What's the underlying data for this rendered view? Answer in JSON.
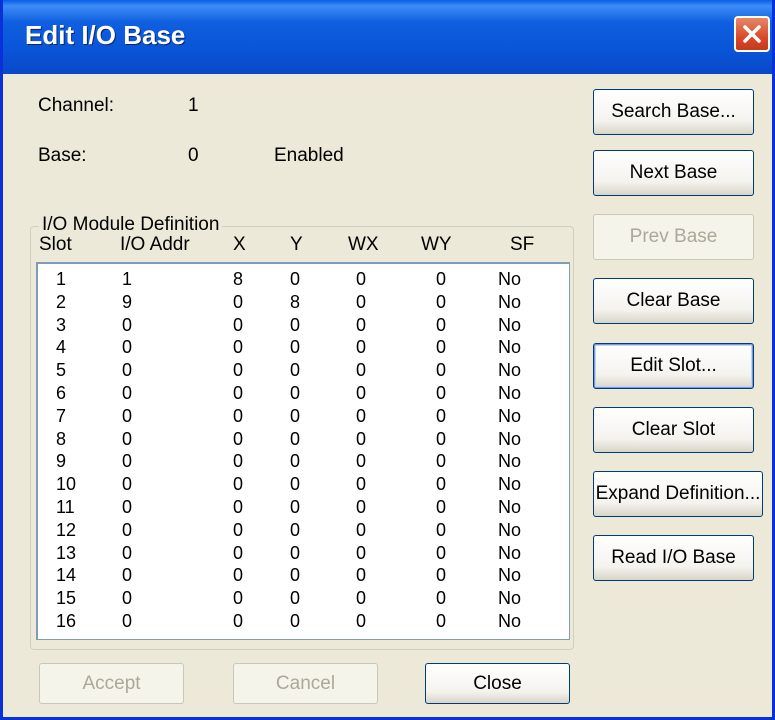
{
  "window": {
    "title": "Edit I/O Base"
  },
  "info": {
    "channel_label": "Channel:",
    "channel_value": "1",
    "base_label": "Base:",
    "base_value": "0",
    "base_status": "Enabled"
  },
  "module_definition": {
    "title": "I/O Module Definition",
    "columns": [
      "Slot",
      "I/O Addr",
      "X",
      "Y",
      "WX",
      "WY",
      "SF"
    ],
    "rows": [
      [
        "1",
        "1",
        "8",
        "0",
        "0",
        "0",
        "No"
      ],
      [
        "2",
        "9",
        "0",
        "8",
        "0",
        "0",
        "No"
      ],
      [
        "3",
        "0",
        "0",
        "0",
        "0",
        "0",
        "No"
      ],
      [
        "4",
        "0",
        "0",
        "0",
        "0",
        "0",
        "No"
      ],
      [
        "5",
        "0",
        "0",
        "0",
        "0",
        "0",
        "No"
      ],
      [
        "6",
        "0",
        "0",
        "0",
        "0",
        "0",
        "No"
      ],
      [
        "7",
        "0",
        "0",
        "0",
        "0",
        "0",
        "No"
      ],
      [
        "8",
        "0",
        "0",
        "0",
        "0",
        "0",
        "No"
      ],
      [
        "9",
        "0",
        "0",
        "0",
        "0",
        "0",
        "No"
      ],
      [
        "10",
        "0",
        "0",
        "0",
        "0",
        "0",
        "No"
      ],
      [
        "11",
        "0",
        "0",
        "0",
        "0",
        "0",
        "No"
      ],
      [
        "12",
        "0",
        "0",
        "0",
        "0",
        "0",
        "No"
      ],
      [
        "13",
        "0",
        "0",
        "0",
        "0",
        "0",
        "No"
      ],
      [
        "14",
        "0",
        "0",
        "0",
        "0",
        "0",
        "No"
      ],
      [
        "15",
        "0",
        "0",
        "0",
        "0",
        "0",
        "No"
      ],
      [
        "16",
        "0",
        "0",
        "0",
        "0",
        "0",
        "No"
      ]
    ]
  },
  "side_buttons": {
    "search_base": "Search Base...",
    "next_base": "Next Base",
    "prev_base": "Prev Base",
    "clear_base": "Clear Base",
    "edit_slot": "Edit Slot...",
    "clear_slot": "Clear Slot",
    "expand_definition": "Expand Definition...",
    "read_io_base": "Read I/O Base"
  },
  "bottom_buttons": {
    "accept": "Accept",
    "cancel": "Cancel",
    "close": "Close"
  },
  "colors": {
    "title_bar": "#0a5de8",
    "dialog_bg": "#ece9d8",
    "close_button": "#d94a2a",
    "disabled_text": "#aca899"
  },
  "icons": {
    "close": "close-x-icon"
  }
}
